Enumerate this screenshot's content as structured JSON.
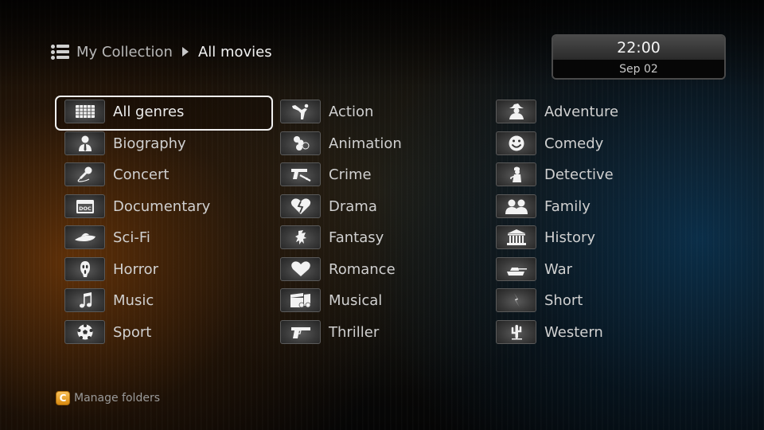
{
  "breadcrumb": {
    "icon": "list-icon",
    "root": "My Collection",
    "separator_icon": "triangle-right-icon",
    "current": "All movies"
  },
  "clock": {
    "time": "22:00",
    "date": "Sep 02"
  },
  "genres": {
    "focused": "All genres",
    "columns": [
      [
        {
          "label": "All genres",
          "icon": "grid-icon"
        },
        {
          "label": "Biography",
          "icon": "person-tie-icon"
        },
        {
          "label": "Concert",
          "icon": "microphone-icon"
        },
        {
          "label": "Documentary",
          "icon": "doc-folder-icon"
        },
        {
          "label": "Sci-Fi",
          "icon": "ufo-icon"
        },
        {
          "label": "Horror",
          "icon": "scream-mask-icon"
        },
        {
          "label": "Music",
          "icon": "music-note-icon"
        },
        {
          "label": "Sport",
          "icon": "soccer-ball-icon"
        }
      ],
      [
        {
          "label": "Action",
          "icon": "karate-kick-icon"
        },
        {
          "label": "Animation",
          "icon": "cartoon-mouse-icon"
        },
        {
          "label": "Crime",
          "icon": "gun-syringe-icon"
        },
        {
          "label": "Drama",
          "icon": "broken-heart-icon"
        },
        {
          "label": "Fantasy",
          "icon": "dragon-icon"
        },
        {
          "label": "Romance",
          "icon": "heart-icon"
        },
        {
          "label": "Musical",
          "icon": "clapper-music-icon"
        },
        {
          "label": "Thriller",
          "icon": "pistol-icon"
        }
      ],
      [
        {
          "label": "Adventure",
          "icon": "explorer-hat-icon"
        },
        {
          "label": "Comedy",
          "icon": "smiley-icon"
        },
        {
          "label": "Detective",
          "icon": "sherlock-icon"
        },
        {
          "label": "Family",
          "icon": "two-people-icon"
        },
        {
          "label": "History",
          "icon": "temple-icon"
        },
        {
          "label": "War",
          "icon": "tank-icon"
        },
        {
          "label": "Short",
          "icon": "lightning-icon"
        },
        {
          "label": "Western",
          "icon": "cactus-icon"
        }
      ]
    ]
  },
  "footer": {
    "key": "C",
    "key_color": "#e8a030",
    "label": "Manage folders"
  }
}
